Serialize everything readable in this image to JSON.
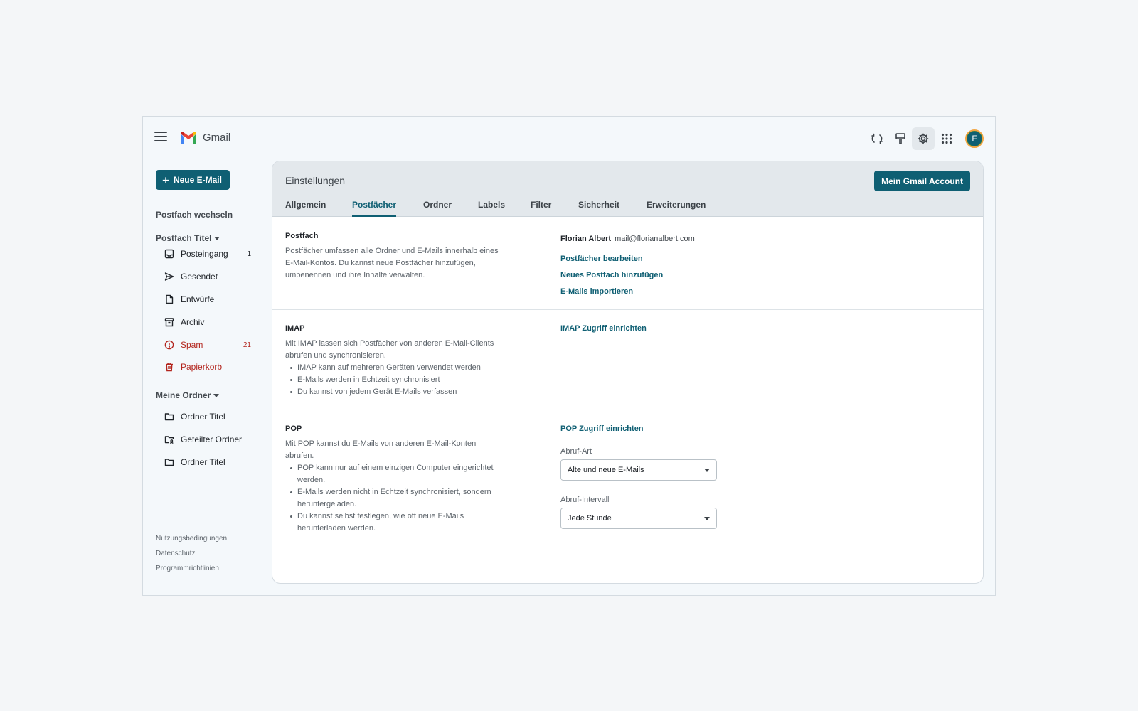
{
  "app": {
    "title": "Gmail"
  },
  "sidebar": {
    "compose_label": "Neue E-Mail",
    "switch_mailbox": "Postfach wechseln",
    "mailbox_title": "Postfach Titel",
    "items": [
      {
        "label": "Posteingang",
        "count": "1",
        "icon": "inbox-icon"
      },
      {
        "label": "Gesendet",
        "count": "",
        "icon": "send-icon"
      },
      {
        "label": "Entwürfe",
        "count": "",
        "icon": "draft-icon"
      },
      {
        "label": "Archiv",
        "count": "",
        "icon": "archive-icon"
      },
      {
        "label": "Spam",
        "count": "21",
        "icon": "spam-icon"
      },
      {
        "label": "Papierkorb",
        "count": "",
        "icon": "trash-icon"
      }
    ],
    "folders_title": "Meine Ordner",
    "folders": [
      {
        "label": "Ordner Titel",
        "icon": "folder-icon"
      },
      {
        "label": "Geteilter Ordner",
        "icon": "shared-folder-icon"
      },
      {
        "label": "Ordner Titel",
        "icon": "folder-icon"
      }
    ],
    "footer": [
      "Nutzungsbedingungen",
      "Datenschutz",
      "Programmrichtlinien"
    ]
  },
  "colors": {
    "accent": "#0f5f73",
    "danger": "#b3261e",
    "panel_header": "#e3e8ec"
  },
  "toolbar_icons": [
    "sync-icon",
    "paint-icon",
    "gear-icon",
    "apps-grid-icon"
  ],
  "user": {
    "avatar_initial": "F"
  },
  "settings": {
    "title": "Einstellungen",
    "account_button": "Mein Gmail Account",
    "tabs": [
      "Allgemein",
      "Postfächer",
      "Ordner",
      "Labels",
      "Filter",
      "Sicherheit",
      "Erweiterungen"
    ],
    "active_tab": "Postfächer",
    "postfach": {
      "title": "Postfach",
      "description": "Postfächer umfassen alle Ordner und E-Mails innerhalb eines E-Mail-Kontos. Du kannst neue Postfächer hinzufügen, umbenennen und ihre Inhalte verwalten.",
      "account_name": "Florian Albert",
      "account_email": "mail@florianalbert.com",
      "links": [
        "Postfächer bearbeiten",
        "Neues Postfach hinzufügen",
        "E-Mails importieren"
      ]
    },
    "imap": {
      "title": "IMAP",
      "description": "Mit IMAP lassen sich Postfächer von anderen E-Mail-Clients abrufen und synchronisieren.",
      "bullets": [
        "IMAP kann auf mehreren Geräten verwendet werden",
        "E-Mails werden in Echtzeit synchronisiert",
        "Du kannst von jedem Gerät E-Mails verfassen"
      ],
      "link": "IMAP Zugriff einrichten"
    },
    "pop": {
      "title": "POP",
      "description": "Mit POP kannst du E-Mails von anderen E-Mail-Konten abrufen.",
      "bullets": [
        "POP kann nur auf einem einzigen Computer eingerichtet werden.",
        "E-Mails werden nicht in Echtzeit synchronisiert, sondern heruntergeladen.",
        "Du kannst selbst festlegen, wie oft neue E-Mails herunterladen werden."
      ],
      "link": "POP Zugriff einrichten",
      "fetch_type_label": "Abruf-Art",
      "fetch_type_value": "Alte und neue E-Mails",
      "fetch_interval_label": "Abruf-Intervall",
      "fetch_interval_value": "Jede Stunde"
    }
  }
}
